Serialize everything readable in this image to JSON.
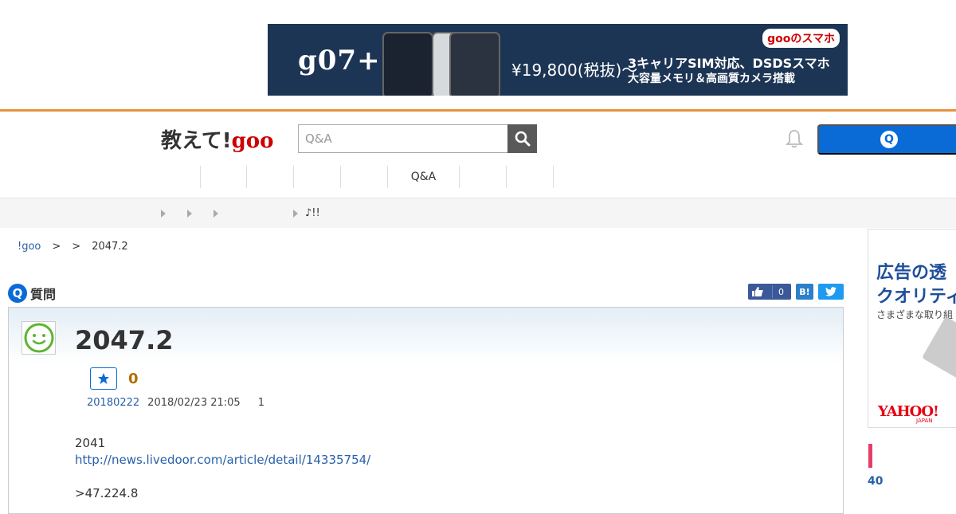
{
  "ad_banner": {
    "brand": "g07++",
    "tag": "gooのスマホ",
    "price": "¥19,800(税抜)〜",
    "headline": "3キャリアSIM対応、DSDSスマホ",
    "subline": "大容量メモリ＆高画質カメラ搭載"
  },
  "header": {
    "logo_text": "教えて!",
    "logo_goo": "goo",
    "search_placeholder": "Q&A",
    "search_icon": "search-icon",
    "bell_icon": "bell-icon",
    "ask_icon_label": "Q"
  },
  "nav": {
    "items": [
      "",
      "",
      "",
      "",
      "Q&A",
      "",
      ""
    ]
  },
  "subbar": {
    "text": "♪!!"
  },
  "breadcrumb": {
    "home": "!goo",
    "sep1": ">",
    "sep2": ">",
    "current": "2047.2"
  },
  "question": {
    "section_label": "質問",
    "section_icon_label": "Q",
    "title": "2047.2",
    "fav_count": "0",
    "user": "20180222",
    "date": "2018/02/23 21:05",
    "answers": "1",
    "body_line1": "2041",
    "body_url": "http://news.livedoor.com/article/detail/14335754/",
    "body_line3": ">47.224.8"
  },
  "share": {
    "like_count": "0",
    "hatena_label": "B!"
  },
  "side_ad": {
    "line1": "広告の透",
    "line2": "クオリティ",
    "line3": "さまざまな取り組",
    "yahoo": "YAHOO!",
    "yahoo_sub": "JAPAN"
  },
  "side": {
    "rank_number": "40"
  },
  "colors": {
    "accent_orange": "#e8913e",
    "brand_blue": "#0b6bd6",
    "link_blue": "#2760a8",
    "goo_red": "#cc0000"
  }
}
